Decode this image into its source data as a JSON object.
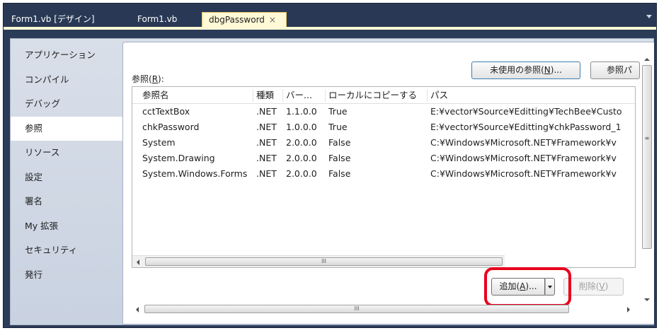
{
  "tabs": {
    "design": "Form1.vb [デザイン]",
    "code": "Form1.vb",
    "active": "dbgPassword",
    "close_glyph": "×"
  },
  "sidebar": {
    "items": [
      {
        "label": "アプリケーション"
      },
      {
        "label": "コンパイル"
      },
      {
        "label": "デバッグ"
      },
      {
        "label": "参照",
        "selected": true
      },
      {
        "label": "リソース"
      },
      {
        "label": "設定"
      },
      {
        "label": "署名"
      },
      {
        "label": "My 拡張"
      },
      {
        "label": "セキュリティ"
      },
      {
        "label": "発行"
      }
    ]
  },
  "references": {
    "label_prefix": "参照(",
    "label_key": "R",
    "label_suffix": "):",
    "unused_button": {
      "prefix": "未使用の参照(",
      "key": "N",
      "suffix": ")..."
    },
    "ref_button": "参照パ",
    "columns": [
      "参照名",
      "種類",
      "バー...",
      "ローカルにコピーする",
      "パス"
    ],
    "rows": [
      [
        "cctTextBox",
        ".NET",
        "1.1.0.0",
        "True",
        "E:¥vector¥Source¥Editting¥TechBee¥Custo"
      ],
      [
        "chkPassword",
        ".NET",
        "1.0.0.0",
        "True",
        "E:¥vector¥Source¥Editting¥chkPassword_1"
      ],
      [
        "System",
        ".NET",
        "2.0.0.0",
        "False",
        "C:¥Windows¥Microsoft.NET¥Framework¥v"
      ],
      [
        "System.Drawing",
        ".NET",
        "2.0.0.0",
        "False",
        "C:¥Windows¥Microsoft.NET¥Framework¥v"
      ],
      [
        "System.Windows.Forms",
        ".NET",
        "2.0.0.0",
        "False",
        "C:¥Windows¥Microsoft.NET¥Framework¥v"
      ]
    ],
    "add_button": {
      "prefix": "追加(",
      "key": "A",
      "suffix": ")..."
    },
    "remove_button": {
      "prefix": "削除(",
      "key": "V",
      "suffix": ")"
    },
    "scroll_grip": "III",
    "vscroll_grip": "≡"
  },
  "colors": {
    "frame": "#2b3c59",
    "active_tab": "#fff9d6",
    "highlight": "#e8001c"
  }
}
